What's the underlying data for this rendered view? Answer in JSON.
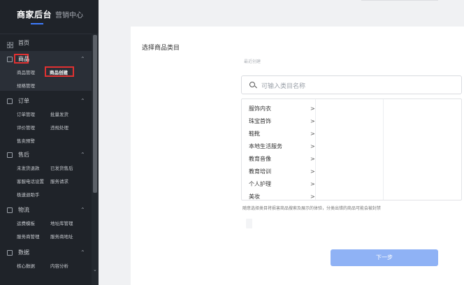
{
  "sidebar": {
    "brand": "商家后台",
    "marketing": "营销中心",
    "sections": [
      {
        "label": "首页",
        "icon": "grid-icon"
      },
      {
        "label": "商品",
        "icon": "bag-icon",
        "items": [
          "商品管理",
          "商品创建",
          "规格管理"
        ]
      },
      {
        "label": "订单",
        "icon": "order-icon",
        "items": [
          "订单管理",
          "批量发货",
          "评价管理",
          "违规处理",
          "售卖预警"
        ]
      },
      {
        "label": "售后",
        "icon": "aftersale-icon",
        "items": [
          "未发货退款",
          "已发货售后",
          "客服电话设置",
          "服务请求",
          "极速退助手"
        ]
      },
      {
        "label": "物流",
        "icon": "truck-icon",
        "items": [
          "运费模板",
          "地址库管理",
          "服务商管理",
          "服务商地址"
        ]
      },
      {
        "label": "数据",
        "icon": "chart-icon",
        "items": [
          "核心数据",
          "内容分析"
        ]
      }
    ]
  },
  "main": {
    "title": "选择商品类目",
    "recent_label": "最近创建",
    "search_placeholder": "可输入类目名称",
    "categories": [
      "服饰内衣",
      "珠宝首饰",
      "鞋靴",
      "本地生活服务",
      "教育音像",
      "教育培训",
      "个人护理",
      "美妆"
    ],
    "tip": "随意选择类目将损害商品搜索及展示的体验，分类出错的商品可能会被封禁",
    "next_button": "下一步"
  },
  "colors": {
    "sidebar_bg": "#1f2329",
    "accent": "#3e7cff",
    "highlight": "#e03131",
    "button_disabled": "#8fb2f5"
  }
}
